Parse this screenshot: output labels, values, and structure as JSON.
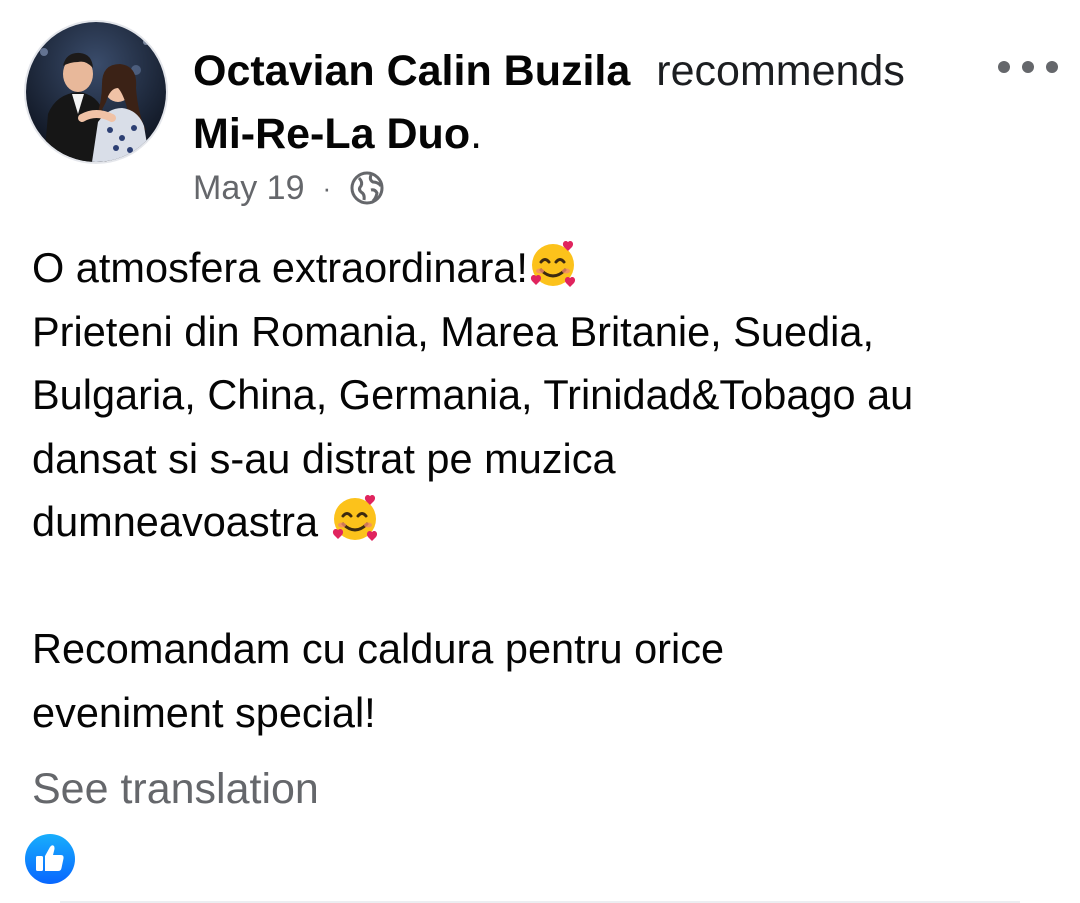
{
  "post": {
    "author": "Octavian Calin Buzila",
    "action": "recommends",
    "page_name": "Mi-Re-La Duo",
    "page_suffix": ".",
    "date": "May 19",
    "separator": "·",
    "privacy_icon": "globe-icon",
    "more_icon": "more-options-icon",
    "body_lines": [
      "O atmosfera extraordinara!",
      "Prieteni din Romania, Marea Britanie, Suedia,",
      "Bulgaria, China, Germania, Trinidad&Tobago au",
      "dansat si s-au distrat pe muzica",
      "dumneavoastra ",
      "",
      "Recomandam cu caldura pentru orice",
      "eveniment special!"
    ],
    "emoji_icon": "smiling-face-with-hearts-icon",
    "see_translation": "See translation",
    "reaction_icon": "like-icon"
  },
  "colors": {
    "primary_text": "#050505",
    "secondary_text": "#65676b",
    "like_blue": "#1877f2"
  }
}
